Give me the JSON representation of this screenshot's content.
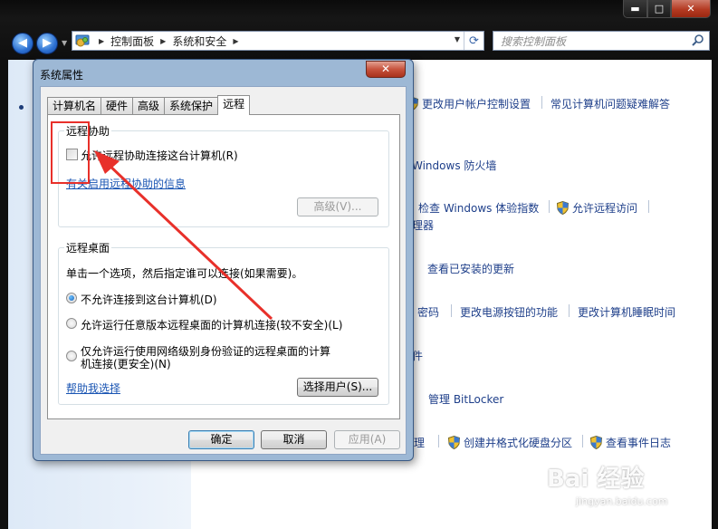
{
  "explorer": {
    "caption_buttons": {
      "minimize": "▬",
      "maximize": "□",
      "close": "✕"
    },
    "nav": {
      "back": "◀",
      "forward": "▶"
    },
    "address": {
      "crumbs": [
        "控制面板",
        "系统和安全"
      ],
      "separator": "▶"
    },
    "search": {
      "placeholder": "搜索控制面板"
    },
    "links": {
      "uac": "更改用户帐户控制设置",
      "troubleshoot": "常见计算机问题疑难解答",
      "firewall": "Windows 防火墙",
      "experience_index": "检查 Windows 体验指数",
      "remote_access": "允许远程访问",
      "device_manager_tail": "理器",
      "installed_updates": "查看已安装的更新",
      "password_tail": "密码",
      "power_buttons": "更改电源按钮的功能",
      "sleep_time": "更改计算机睡眠时间",
      "backup_tail": "件",
      "bitlocker": "管理 BitLocker",
      "disk_tail": "理",
      "format_disk": "创建并格式化硬盘分区",
      "event_log": "查看事件日志"
    }
  },
  "dialog": {
    "title": "系统属性",
    "close": "✕",
    "tabs": [
      "计算机名",
      "硬件",
      "高级",
      "系统保护",
      "远程"
    ],
    "remote_assistance": {
      "group_title": "远程协助",
      "checkbox_label": "允许远程协助连接这台计算机(R)",
      "info_link": "有关启用远程协助的信息",
      "advanced_button": "高级(V)..."
    },
    "remote_desktop": {
      "group_title": "远程桌面",
      "instruction": "单击一个选项，然后指定谁可以连接(如果需要)。",
      "options": [
        "不允许连接到这台计算机(D)",
        "允许运行任意版本远程桌面的计算机连接(较不安全)(L)",
        "仅允许运行使用网络级别身份验证的远程桌面的计算",
        "机连接(更安全)(N)"
      ],
      "help_link": "帮助我选择",
      "select_users_button": "选择用户(S)..."
    },
    "buttons": {
      "ok": "确定",
      "cancel": "取消",
      "apply": "应用(A)"
    }
  },
  "watermark": {
    "brand": "Bai 经验",
    "url": "jingyan.baidu.com"
  },
  "colors": {
    "accent": "#1e3f8a",
    "annotation": "#e8302a"
  }
}
